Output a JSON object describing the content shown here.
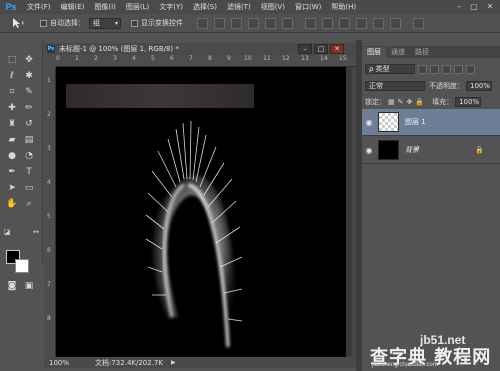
{
  "app": {
    "logo": "Ps"
  },
  "menubar": {
    "items": [
      "文件(F)",
      "编辑(E)",
      "图像(I)",
      "图层(L)",
      "文字(Y)",
      "选择(S)",
      "滤镜(T)",
      "视图(V)",
      "窗口(W)",
      "帮助(H)"
    ],
    "window_controls": [
      "–",
      "□",
      "✕"
    ]
  },
  "options": {
    "tool_icon": "move-tool-icon",
    "auto_select_label": "自动选择：",
    "auto_select_value": "组",
    "transform_label": "显示变换控件"
  },
  "document": {
    "tab_icon": "Ps",
    "title": "未标题-1 @ 100% (图层 1, RGB/8) *",
    "controls": [
      "–",
      "□",
      "✕"
    ],
    "ruler_top": [
      "0",
      "1",
      "2",
      "3",
      "4",
      "5",
      "6",
      "7",
      "8",
      "9",
      "10",
      "11",
      "12",
      "13",
      "14",
      "15"
    ],
    "ruler_left": [
      "1",
      "2",
      "3",
      "4",
      "5",
      "6",
      "7",
      "8"
    ],
    "status_zoom": "100%",
    "status_doc": "文档:732.4K/202.7K"
  },
  "layers_panel": {
    "tabs": [
      "图层",
      "通道",
      "路径"
    ],
    "filter_kind": "ρ 类型",
    "blend_mode": "正常",
    "opacity_label": "不透明度：",
    "opacity_value": "100%",
    "lock_label": "锁定：",
    "fill_label": "填充：",
    "fill_value": "100%",
    "layers": [
      {
        "name": "图层 1",
        "selected": true,
        "thumb": "transparent"
      },
      {
        "name": "背景",
        "selected": false,
        "thumb": "black",
        "locked": true
      }
    ]
  },
  "watermark": {
    "site": "jb51.net",
    "brand": "查字典 教程网",
    "url": "jiaocheng.chazidian.com"
  },
  "colors": {
    "foreground": "#000000",
    "background": "#ffffff",
    "selected_layer": "#6d7f96"
  }
}
